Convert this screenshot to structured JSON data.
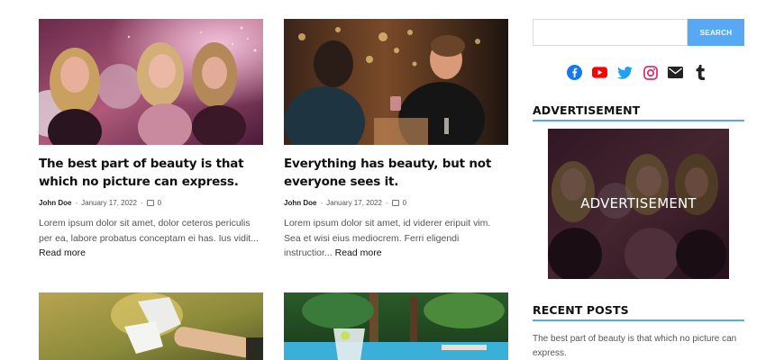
{
  "posts": [
    {
      "title": "The best part of beauty is that which no picture can express.",
      "author": "John Doe",
      "date": "January 17, 2022",
      "comments": "0",
      "excerpt": "Lorem ipsum dolor sit amet, dolor ceteros periculis per ea, labore probatus conceptam ei has. Ius vidit...",
      "read_more": "Read more"
    },
    {
      "title": "Everything has beauty, but not everyone sees it.",
      "author": "John Doe",
      "date": "January 17, 2022",
      "comments": "0",
      "excerpt": "Lorem ipsum dolor sit amet, id viderer eripuit vim. Sea et wisi eius mediocrem. Ferri eligendi instructior...",
      "read_more": "Read more"
    }
  ],
  "sidebar": {
    "search_button": "SEARCH",
    "search_placeholder": "",
    "social_icons": [
      "facebook-icon",
      "youtube-icon",
      "twitter-icon",
      "instagram-icon",
      "mail-icon",
      "tumblr-icon"
    ],
    "advertisement_title": "ADVERTISEMENT",
    "ad_label": "ADVERTISEMENT",
    "recent_title": "RECENT POSTS",
    "recent_posts": [
      "The best part of beauty is that which no picture can express."
    ]
  },
  "colors": {
    "accent": "#58a9f4",
    "facebook": "#1877f2",
    "youtube": "#ff0000",
    "twitter": "#1da1f2",
    "instagram": "#e1306c",
    "dark": "#222222"
  }
}
